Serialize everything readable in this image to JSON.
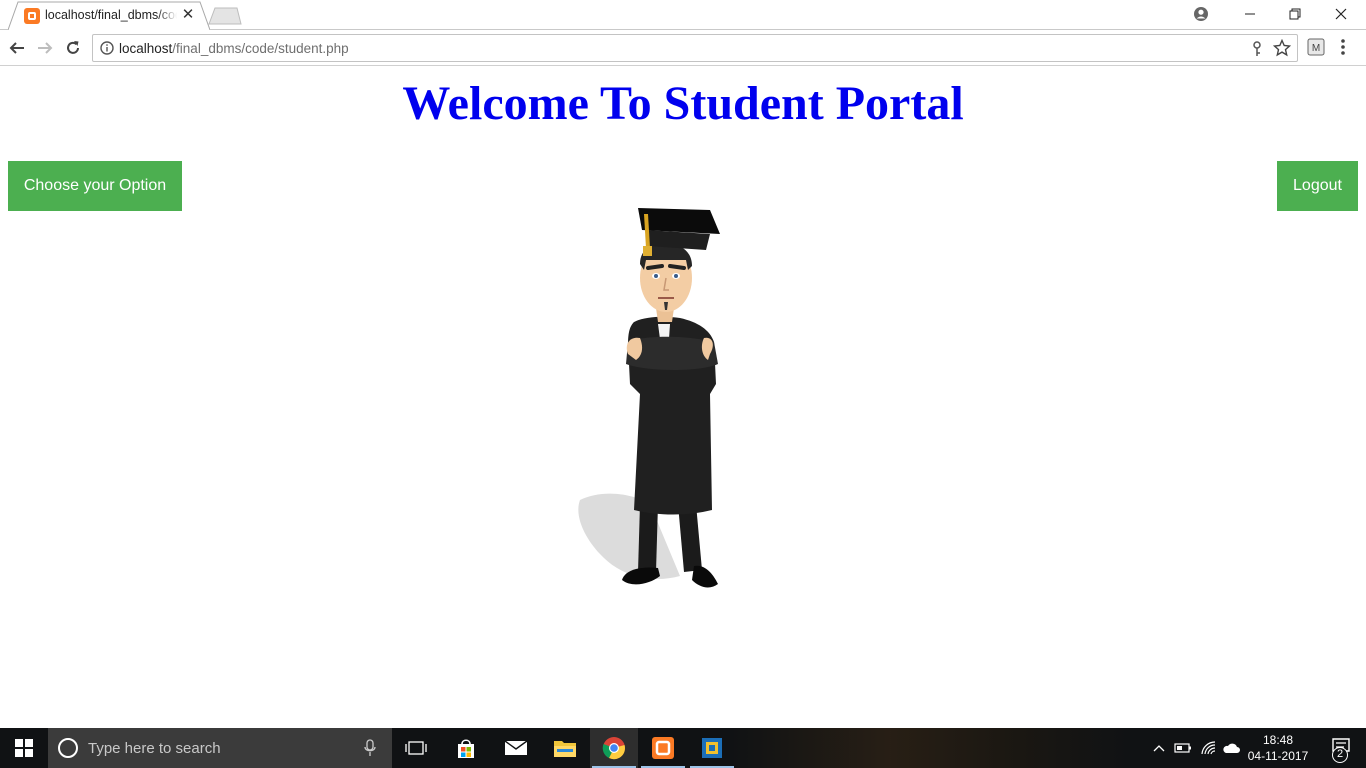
{
  "browser": {
    "tab_title": "localhost/final_dbms/code/student.php",
    "url_host": "localhost",
    "url_rest": "/final_dbms/code/student.php"
  },
  "page": {
    "heading": "Welcome To Student Portal",
    "choose_option_label": "Choose your Option",
    "logout_label": "Logout",
    "accent_color": "#4caf50",
    "heading_color": "#0000ee"
  },
  "taskbar": {
    "search_placeholder": "Type here to search",
    "time": "18:48",
    "date": "04-11-2017",
    "notification_count": "2",
    "apps": [
      "task-view",
      "store",
      "mail",
      "file-explorer",
      "chrome",
      "xampp",
      "virtualbox"
    ]
  }
}
